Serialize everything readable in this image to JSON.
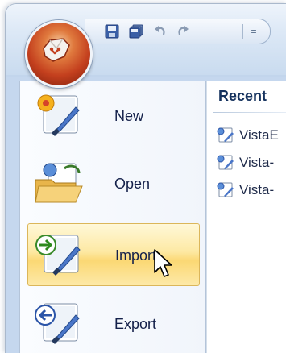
{
  "app_menu": {
    "orb_icon": "office-orb-icon",
    "quick_access": [
      {
        "name": "save-icon"
      },
      {
        "name": "save-all-icon"
      },
      {
        "name": "undo-icon"
      },
      {
        "name": "redo-icon"
      }
    ],
    "qat_dropdown_glyph": "="
  },
  "menu": {
    "items": [
      {
        "label": "New",
        "icon": "new-document-icon"
      },
      {
        "label": "Open",
        "icon": "open-folder-icon"
      },
      {
        "label": "Import",
        "icon": "import-icon",
        "state": "hover"
      },
      {
        "label": "Export",
        "icon": "export-icon"
      }
    ]
  },
  "recent": {
    "title": "Recent",
    "items": [
      {
        "label": "VistaE"
      },
      {
        "label": "Vista-"
      },
      {
        "label": "Vista-"
      }
    ]
  },
  "colors": {
    "hover_gold": "#fbd874",
    "ribbon_blue": "#c5d7ee",
    "orb_red": "#c4401e"
  }
}
